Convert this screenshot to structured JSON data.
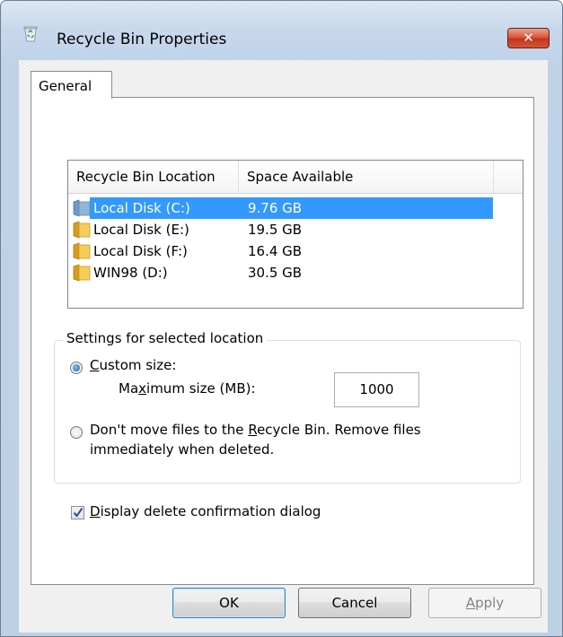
{
  "window": {
    "title": "Recycle Bin Properties",
    "close_glyph": "✕",
    "icon": "recycle-bin-icon"
  },
  "tabs": [
    {
      "label": "General",
      "selected": true
    }
  ],
  "list": {
    "columns": [
      "Recycle Bin Location",
      "Space Available"
    ],
    "rows": [
      {
        "location": "Local Disk (C:)",
        "space": "9.76 GB",
        "selected": true,
        "icon": "drive-icon"
      },
      {
        "location": "Local Disk (E:)",
        "space": "19.5 GB",
        "selected": false,
        "icon": "folder-icon"
      },
      {
        "location": "Local Disk (F:)",
        "space": "16.4 GB",
        "selected": false,
        "icon": "folder-icon"
      },
      {
        "location": "WIN98 (D:)",
        "space": "30.5 GB",
        "selected": false,
        "icon": "folder-icon"
      }
    ]
  },
  "settings": {
    "group_label": "Settings for selected location",
    "custom_size_label_pre": "",
    "custom_size_label_u": "C",
    "custom_size_label_post": "ustom size:",
    "max_size_label_pre": "Ma",
    "max_size_label_u": "x",
    "max_size_label_post": "imum size (MB):",
    "max_size_value": "1000",
    "dont_move_line1_pre": "Don't move files to the ",
    "dont_move_line1_u": "R",
    "dont_move_line1_post": "ecycle Bin. Remove files",
    "dont_move_line2": "immediately when deleted.",
    "selected_option": "custom_size"
  },
  "confirm": {
    "label_u": "D",
    "label_post": "isplay delete confirmation dialog",
    "checked": true
  },
  "buttons": {
    "ok": "OK",
    "cancel": "Cancel",
    "apply_u": "A",
    "apply_post": "pply"
  },
  "colors": {
    "selection": "#3399ff",
    "close": "#c3361c",
    "folder": "#e8b530"
  }
}
